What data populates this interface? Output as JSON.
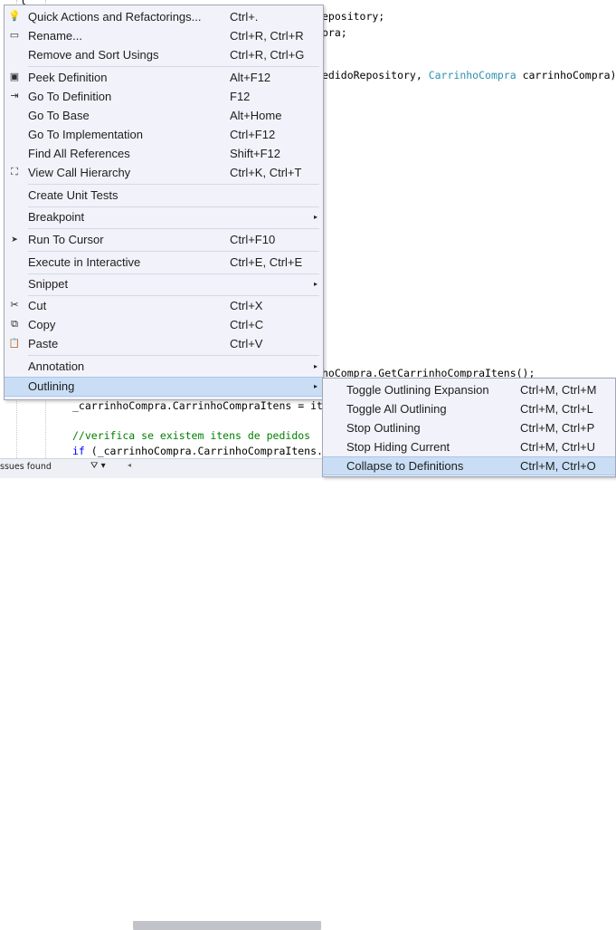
{
  "editor": {
    "lines": [
      {
        "text": "epository;"
      },
      {
        "text": "pra;"
      },
      {
        "text_a": "edidoRepository, ",
        "type": "CarrinhoCompra",
        "text_b": " carrinhoCompra)"
      },
      {
        "text": "hoCompra.GetCarrinhoCompraItens();"
      },
      {
        "text": "_carrinhoCompra.CarrinhoCompraItens = it"
      },
      {
        "comment": "//verifica se existem itens de pedidos"
      },
      {
        "kw": "if",
        "text": " (_carrinhoCompra.CarrinhoCompraItens."
      }
    ],
    "top_brace": "{"
  },
  "status": {
    "issues": "ssues found",
    "filter_glyph": "⛛ ▾"
  },
  "context_menu": {
    "items": [
      {
        "label": "Quick Actions and Refactorings...",
        "shortcut": "Ctrl+.",
        "icon": "lightbulb-icon",
        "glyph": "💡"
      },
      {
        "label": "Rename...",
        "shortcut": "Ctrl+R, Ctrl+R",
        "icon": "rename-icon",
        "glyph": "▭"
      },
      {
        "label": "Remove and Sort Usings",
        "shortcut": "Ctrl+R, Ctrl+G",
        "icon": "",
        "glyph": ""
      },
      {
        "label": "Peek Definition",
        "shortcut": "Alt+F12",
        "icon": "peek-definition-icon",
        "glyph": "▣"
      },
      {
        "label": "Go To Definition",
        "shortcut": "F12",
        "icon": "go-to-definition-icon",
        "glyph": "⇥"
      },
      {
        "label": "Go To Base",
        "shortcut": "Alt+Home",
        "icon": "",
        "glyph": ""
      },
      {
        "label": "Go To Implementation",
        "shortcut": "Ctrl+F12",
        "icon": "",
        "glyph": ""
      },
      {
        "label": "Find All References",
        "shortcut": "Shift+F12",
        "icon": "",
        "glyph": ""
      },
      {
        "label": "View Call Hierarchy",
        "shortcut": "Ctrl+K, Ctrl+T",
        "icon": "call-hierarchy-icon",
        "glyph": "⛶"
      },
      {
        "label": "Create Unit Tests",
        "shortcut": "",
        "icon": "",
        "glyph": ""
      },
      {
        "label": "Breakpoint",
        "shortcut": "",
        "icon": "",
        "glyph": "",
        "submenu": true
      },
      {
        "label": "Run To Cursor",
        "shortcut": "Ctrl+F10",
        "icon": "run-to-cursor-icon",
        "glyph": "➤"
      },
      {
        "label": "Execute in Interactive",
        "shortcut": "Ctrl+E, Ctrl+E",
        "icon": "",
        "glyph": ""
      },
      {
        "label": "Snippet",
        "shortcut": "",
        "icon": "",
        "glyph": "",
        "submenu": true
      },
      {
        "label": "Cut",
        "shortcut": "Ctrl+X",
        "icon": "scissors-icon",
        "glyph": "✂"
      },
      {
        "label": "Copy",
        "shortcut": "Ctrl+C",
        "icon": "copy-icon",
        "glyph": "⧉"
      },
      {
        "label": "Paste",
        "shortcut": "Ctrl+V",
        "icon": "paste-icon",
        "glyph": "📋"
      },
      {
        "label": "Annotation",
        "shortcut": "",
        "icon": "",
        "glyph": "",
        "submenu": true
      },
      {
        "label": "Outlining",
        "shortcut": "",
        "icon": "",
        "glyph": "",
        "submenu": true,
        "highlighted": true
      }
    ],
    "arrow_glyph": "▸"
  },
  "submenu": {
    "items": [
      {
        "label": "Toggle Outlining Expansion",
        "shortcut": "Ctrl+M, Ctrl+M"
      },
      {
        "label": "Toggle All Outlining",
        "shortcut": "Ctrl+M, Ctrl+L"
      },
      {
        "label": "Stop Outlining",
        "shortcut": "Ctrl+M, Ctrl+P"
      },
      {
        "label": "Stop Hiding Current",
        "shortcut": "Ctrl+M, Ctrl+U"
      },
      {
        "label": "Collapse to Definitions",
        "shortcut": "Ctrl+M, Ctrl+O",
        "highlighted": true
      }
    ]
  },
  "colors": {
    "menu_bg": "#f2f2fa",
    "highlight": "#c9def5",
    "keyword": "#0000ff",
    "type": "#2b91af",
    "comment": "#008000"
  }
}
